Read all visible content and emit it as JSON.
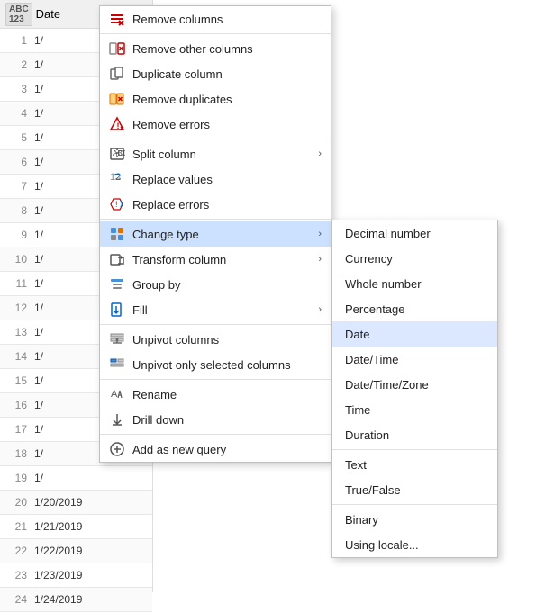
{
  "table": {
    "column_header": "Date",
    "type_badge": "ABC\n123",
    "rows": [
      {
        "num": 1,
        "val": "1/"
      },
      {
        "num": 2,
        "val": "1/"
      },
      {
        "num": 3,
        "val": "1/"
      },
      {
        "num": 4,
        "val": "1/"
      },
      {
        "num": 5,
        "val": "1/"
      },
      {
        "num": 6,
        "val": "1/"
      },
      {
        "num": 7,
        "val": "1/"
      },
      {
        "num": 8,
        "val": "1/"
      },
      {
        "num": 9,
        "val": "1/"
      },
      {
        "num": 10,
        "val": "1/"
      },
      {
        "num": 11,
        "val": "1/"
      },
      {
        "num": 12,
        "val": "1/"
      },
      {
        "num": 13,
        "val": "1/"
      },
      {
        "num": 14,
        "val": "1/"
      },
      {
        "num": 15,
        "val": "1/"
      },
      {
        "num": 16,
        "val": "1/"
      },
      {
        "num": 17,
        "val": "1/"
      },
      {
        "num": 18,
        "val": "1/"
      },
      {
        "num": 19,
        "val": "1/"
      },
      {
        "num": 20,
        "val": "1/20/2019"
      },
      {
        "num": 21,
        "val": "1/21/2019"
      },
      {
        "num": 22,
        "val": "1/22/2019"
      },
      {
        "num": 23,
        "val": "1/23/2019"
      },
      {
        "num": 24,
        "val": "1/24/2019"
      }
    ]
  },
  "context_menu": {
    "items": [
      {
        "id": "remove-columns",
        "label": "Remove columns",
        "icon": "×",
        "has_arrow": false
      },
      {
        "id": "remove-other-columns",
        "label": "Remove other columns",
        "icon": "≡×",
        "has_arrow": false
      },
      {
        "id": "duplicate-column",
        "label": "Duplicate column",
        "icon": "⧉",
        "has_arrow": false
      },
      {
        "id": "remove-duplicates",
        "label": "Remove duplicates",
        "icon": "≣",
        "has_arrow": false
      },
      {
        "id": "remove-errors",
        "label": "Remove errors",
        "icon": "⚑×",
        "has_arrow": false
      },
      {
        "id": "split-column",
        "label": "Split column",
        "icon": "↔",
        "has_arrow": true
      },
      {
        "id": "replace-values",
        "label": "Replace values",
        "icon": "↺",
        "has_arrow": false
      },
      {
        "id": "replace-errors",
        "label": "Replace errors",
        "icon": "↺",
        "has_arrow": false
      },
      {
        "id": "change-type",
        "label": "Change type",
        "icon": "⊞",
        "has_arrow": true,
        "highlighted": true
      },
      {
        "id": "transform-column",
        "label": "Transform column",
        "icon": "⊡",
        "has_arrow": true
      },
      {
        "id": "group-by",
        "label": "Group by",
        "icon": "∑",
        "has_arrow": false
      },
      {
        "id": "fill",
        "label": "Fill",
        "icon": "↓",
        "has_arrow": true
      },
      {
        "id": "unpivot-columns",
        "label": "Unpivot columns",
        "icon": "↕",
        "has_arrow": false
      },
      {
        "id": "unpivot-only-selected",
        "label": "Unpivot only selected columns",
        "icon": "↕",
        "has_arrow": false
      },
      {
        "id": "rename",
        "label": "Rename",
        "icon": "✏",
        "has_arrow": false
      },
      {
        "id": "drill-down",
        "label": "Drill down",
        "icon": "⬇",
        "has_arrow": false
      },
      {
        "id": "add-as-new-query",
        "label": "Add as new query",
        "icon": "✦",
        "has_arrow": false
      }
    ]
  },
  "submenu": {
    "title": "Change type",
    "items": [
      {
        "id": "decimal-number",
        "label": "Decimal number",
        "selected": false
      },
      {
        "id": "currency",
        "label": "Currency",
        "selected": false
      },
      {
        "id": "whole-number",
        "label": "Whole number",
        "selected": false
      },
      {
        "id": "percentage",
        "label": "Percentage",
        "selected": false
      },
      {
        "id": "date",
        "label": "Date",
        "selected": true
      },
      {
        "id": "datetime",
        "label": "Date/Time",
        "selected": false
      },
      {
        "id": "datetimezone",
        "label": "Date/Time/Zone",
        "selected": false
      },
      {
        "id": "time",
        "label": "Time",
        "selected": false
      },
      {
        "id": "duration",
        "label": "Duration",
        "selected": false
      },
      {
        "id": "text",
        "label": "Text",
        "selected": false
      },
      {
        "id": "truefalse",
        "label": "True/False",
        "selected": false
      },
      {
        "id": "binary",
        "label": "Binary",
        "selected": false
      },
      {
        "id": "using-locale",
        "label": "Using locale...",
        "selected": false
      }
    ]
  }
}
